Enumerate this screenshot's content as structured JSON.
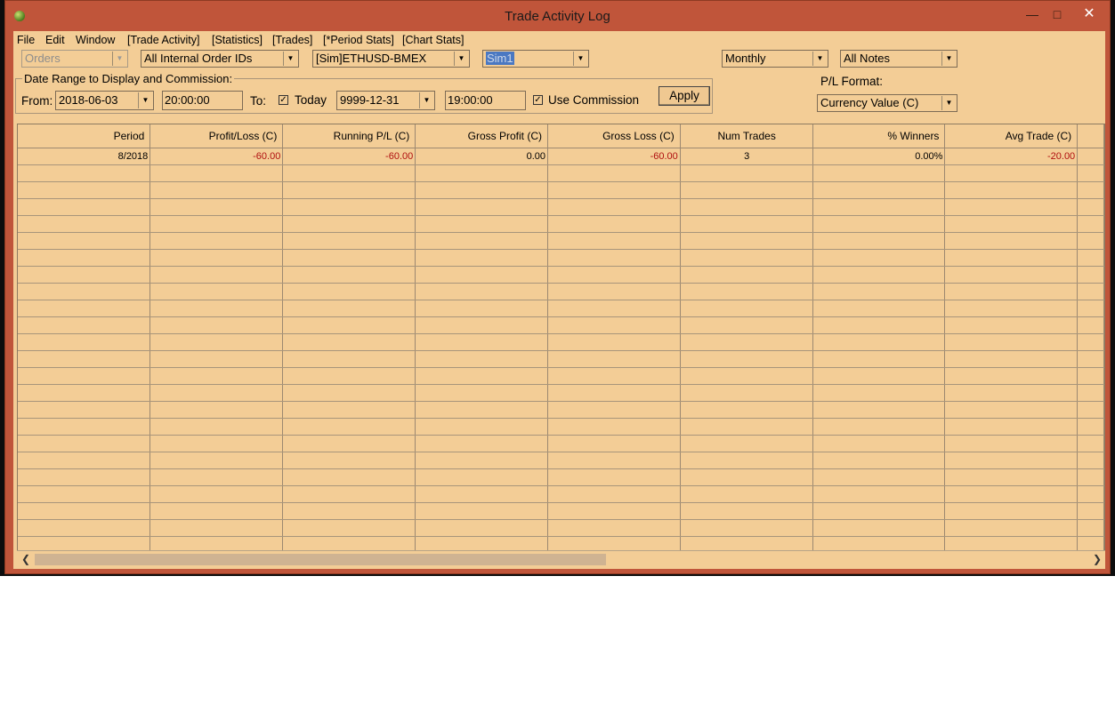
{
  "window": {
    "title": "Trade Activity Log"
  },
  "menu": [
    "File",
    "Edit",
    "Window",
    "[Trade Activity]",
    "[Statistics]",
    "[Trades]",
    "[*Period Stats]",
    "[Chart Stats]"
  ],
  "filters": {
    "orders": "Orders",
    "internal_ids": "All Internal Order IDs",
    "symbol": "[Sim]ETHUSD-BMEX",
    "account": "Sim1",
    "period": "Monthly",
    "notes": "All Notes"
  },
  "date_range": {
    "group_label": "Date Range to Display and Commission:",
    "from_label": "From:",
    "from_date": "2018-06-03",
    "from_time": "20:00:00",
    "to_label": "To:",
    "today_label": "Today",
    "today_checked": true,
    "to_date": "9999-12-31",
    "to_time": "19:00:00",
    "use_commission_label": "Use Commission",
    "use_commission_checked": true,
    "apply_label": "Apply"
  },
  "pl_format": {
    "label": "P/L Format:",
    "value": "Currency Value (C)"
  },
  "table": {
    "columns": [
      "Period",
      "Profit/Loss (C)",
      "Running P/L (C)",
      "Gross Profit (C)",
      "Gross Loss (C)",
      "Num Trades",
      "% Winners",
      "Avg Trade (C)"
    ],
    "rows": [
      [
        "8/2018",
        "-60.00",
        "-60.00",
        "0.00",
        "-60.00",
        "3",
        "0.00%",
        "-20.00"
      ]
    ]
  },
  "colors": {
    "window_frame": "#c0553a",
    "client_bg": "#f3cd96",
    "negative": "#b01010"
  }
}
